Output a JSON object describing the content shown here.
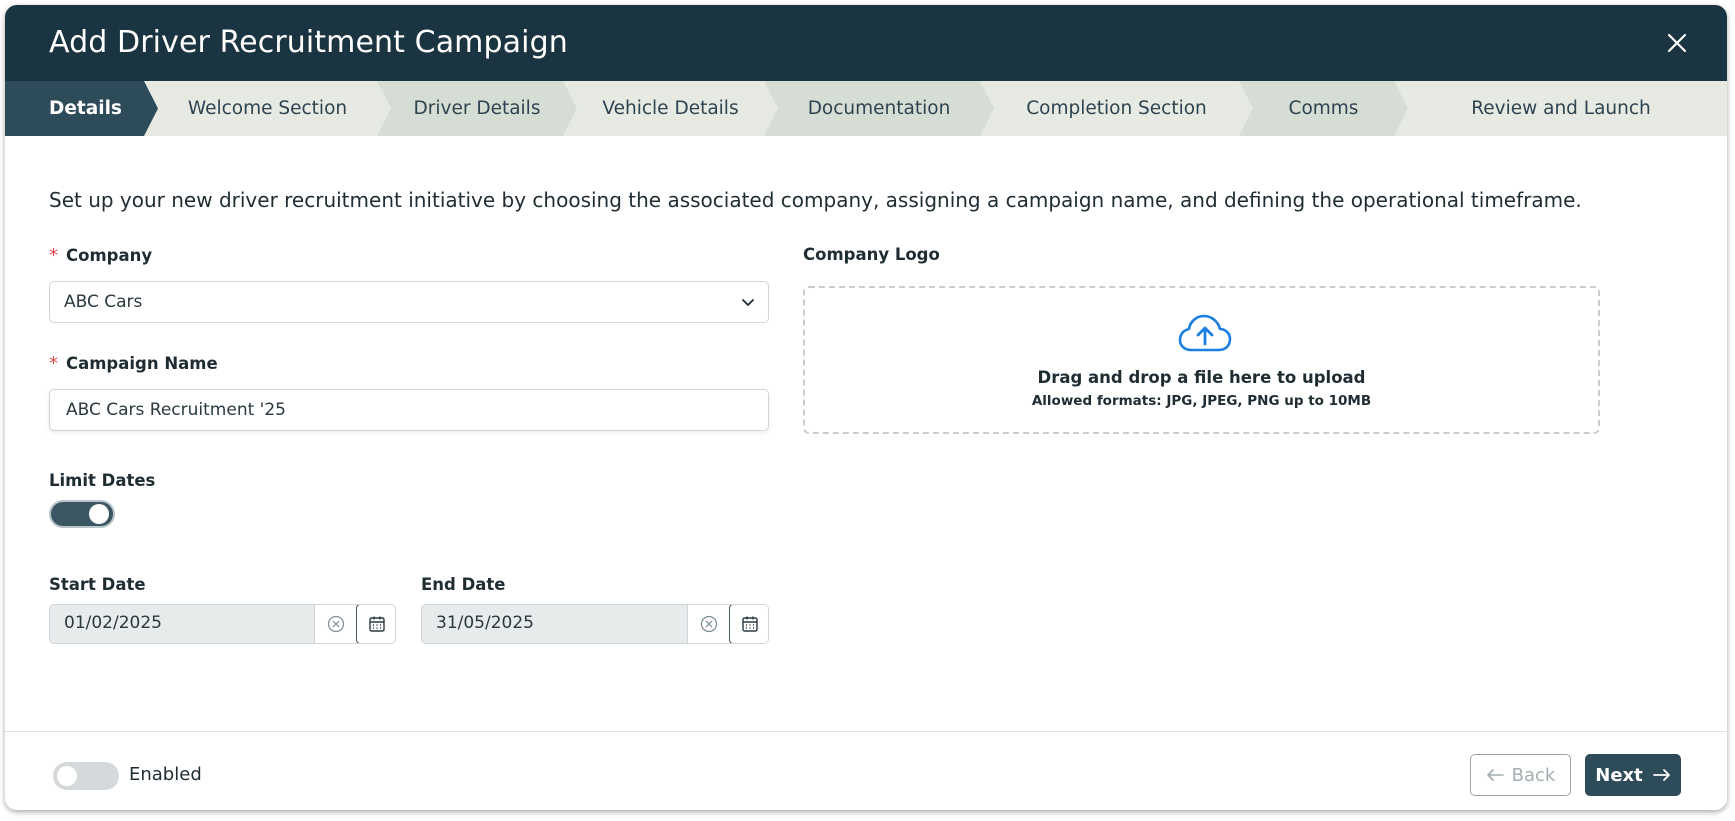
{
  "dialog": {
    "title": "Add Driver Recruitment Campaign"
  },
  "steps": [
    {
      "label": "Details",
      "active": true
    },
    {
      "label": "Welcome Section",
      "active": false
    },
    {
      "label": "Driver Details",
      "active": false
    },
    {
      "label": "Vehicle Details",
      "active": false
    },
    {
      "label": "Documentation",
      "active": false
    },
    {
      "label": "Completion Section",
      "active": false
    },
    {
      "label": "Comms",
      "active": false
    },
    {
      "label": "Review and Launch",
      "active": false
    }
  ],
  "intro": "Set up your new driver recruitment initiative by choosing the associated company, assigning a campaign name, and defining the operational timeframe.",
  "form": {
    "company_label": "Company",
    "company_value": "ABC Cars",
    "campaign_label": "Campaign Name",
    "campaign_value": "ABC Cars Recruitment '25",
    "limit_dates_label": "Limit Dates",
    "limit_dates_on": true,
    "start_label": "Start Date",
    "start_value": "01/02/2025",
    "end_label": "End Date",
    "end_value": "31/05/2025",
    "required_marker": "*"
  },
  "logo": {
    "label": "Company Logo",
    "drop_title": "Drag and drop a file here to upload",
    "drop_sub": "Allowed formats: JPG, JPEG, PNG up to 10MB"
  },
  "footer": {
    "enabled_label": "Enabled",
    "enabled_on": false,
    "back_label": "Back",
    "next_label": "Next"
  },
  "colors": {
    "header_bg": "#1b3441",
    "active_step": "#2e4b5a",
    "required": "#e0474c",
    "upload_icon": "#1a7fe0"
  }
}
